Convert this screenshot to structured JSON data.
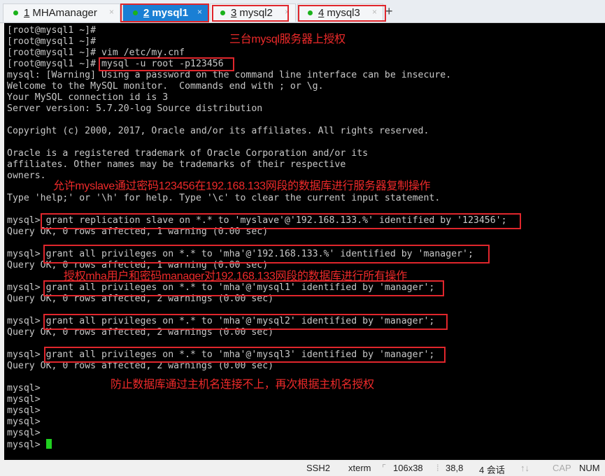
{
  "tabs": [
    {
      "num": "1",
      "label": "MHAmanager",
      "active": false
    },
    {
      "num": "2",
      "label": "mysql1",
      "active": true
    },
    {
      "num": "3",
      "label": "mysql2",
      "active": false
    },
    {
      "num": "4",
      "label": "mysql3",
      "active": false
    }
  ],
  "tab_close": "×",
  "new_tab": "+",
  "terminal": {
    "lines": [
      "[root@mysql1 ~]#",
      "[root@mysql1 ~]#",
      "[root@mysql1 ~]# vim /etc/my.cnf",
      "[root@mysql1 ~]# mysql -u root -p123456",
      "mysql: [Warning] Using a password on the command line interface can be insecure.",
      "Welcome to the MySQL monitor.  Commands end with ; or \\g.",
      "Your MySQL connection id is 3",
      "Server version: 5.7.20-log Source distribution",
      "",
      "Copyright (c) 2000, 2017, Oracle and/or its affiliates. All rights reserved.",
      "",
      "Oracle is a registered trademark of Oracle Corporation and/or its",
      "affiliates. Other names may be trademarks of their respective",
      "owners.",
      "",
      "Type 'help;' or '\\h' for help. Type '\\c' to clear the current input statement.",
      "",
      "mysql> grant replication slave on *.* to 'myslave'@'192.168.133.%' identified by '123456';",
      "Query OK, 0 rows affected, 1 warning (0.00 sec)",
      "",
      "mysql> grant all privileges on *.* to 'mha'@'192.168.133.%' identified by 'manager';",
      "Query OK, 0 rows affected, 1 warning (0.00 sec)",
      "",
      "mysql> grant all privileges on *.* to 'mha'@'mysql1' identified by 'manager';",
      "Query OK, 0 rows affected, 2 warnings (0.00 sec)",
      "",
      "mysql> grant all privileges on *.* to 'mha'@'mysql2' identified by 'manager';",
      "Query OK, 0 rows affected, 2 warnings (0.00 sec)",
      "",
      "mysql> grant all privileges on *.* to 'mha'@'mysql3' identified by 'manager';",
      "Query OK, 0 rows affected, 2 warnings (0.00 sec)",
      "",
      "mysql>",
      "mysql>",
      "mysql>",
      "mysql>",
      "mysql>",
      "mysql> "
    ]
  },
  "annotations": {
    "a1": "三台mysql服务器上授权",
    "a2": "允许myslave通过密码123456在192.168.133网段的数据库进行服务器复制操作",
    "a3": "授权mha用户和密码manager对192.168.133网段的数据库进行所有操作",
    "a4": "防止数据库通过主机名连接不上，再次根据主机名授权"
  },
  "status": {
    "protocol": "SSH2",
    "term": "xterm",
    "size": "106x38",
    "cursor_pos": "38,8",
    "sessions": "4 会话",
    "cap": "CAP",
    "num": "NUM"
  },
  "colors": {
    "annotation": "#ee2a2a",
    "active_tab": "#1a7fd4",
    "cursor": "#20d020"
  }
}
